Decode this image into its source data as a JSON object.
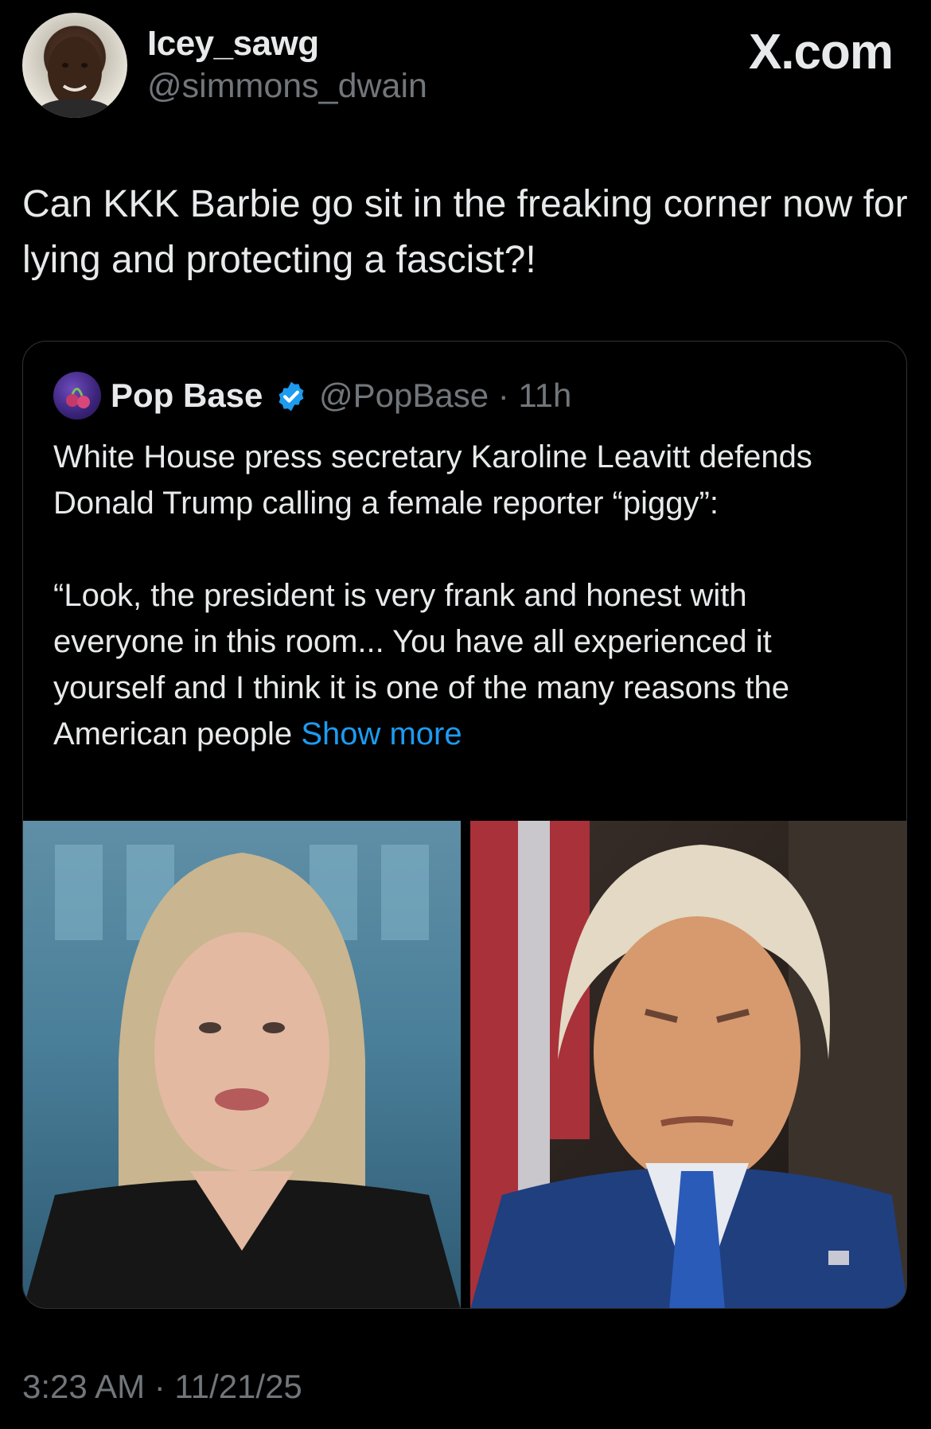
{
  "author": {
    "display_name": "Icey_sawg",
    "handle": "@simmons_dwain"
  },
  "brand": "X.com",
  "tweet": {
    "text": "Can KKK Barbie go sit in the freaking corner now for lying and protecting a fascist?!",
    "timestamp": "3:23 AM · 11/21/25"
  },
  "quoted_tweet": {
    "display_name": "Pop Base",
    "handle_time": "@PopBase · 11h",
    "paragraph_1": "White House press secretary Karoline Leavitt defends Donald Trump calling a female reporter “piggy”:",
    "paragraph_2": "“Look, the president is very frank and honest with everyone in this room... You have all experienced it yourself and I think it is one of the many reasons the American people",
    "show_more": "Show more"
  },
  "colors": {
    "background": "#000000",
    "text_primary": "#e7e9ea",
    "text_secondary": "#71767b",
    "link": "#1d9bf0",
    "verified": "#1d9bf0",
    "border": "#2f3336"
  }
}
